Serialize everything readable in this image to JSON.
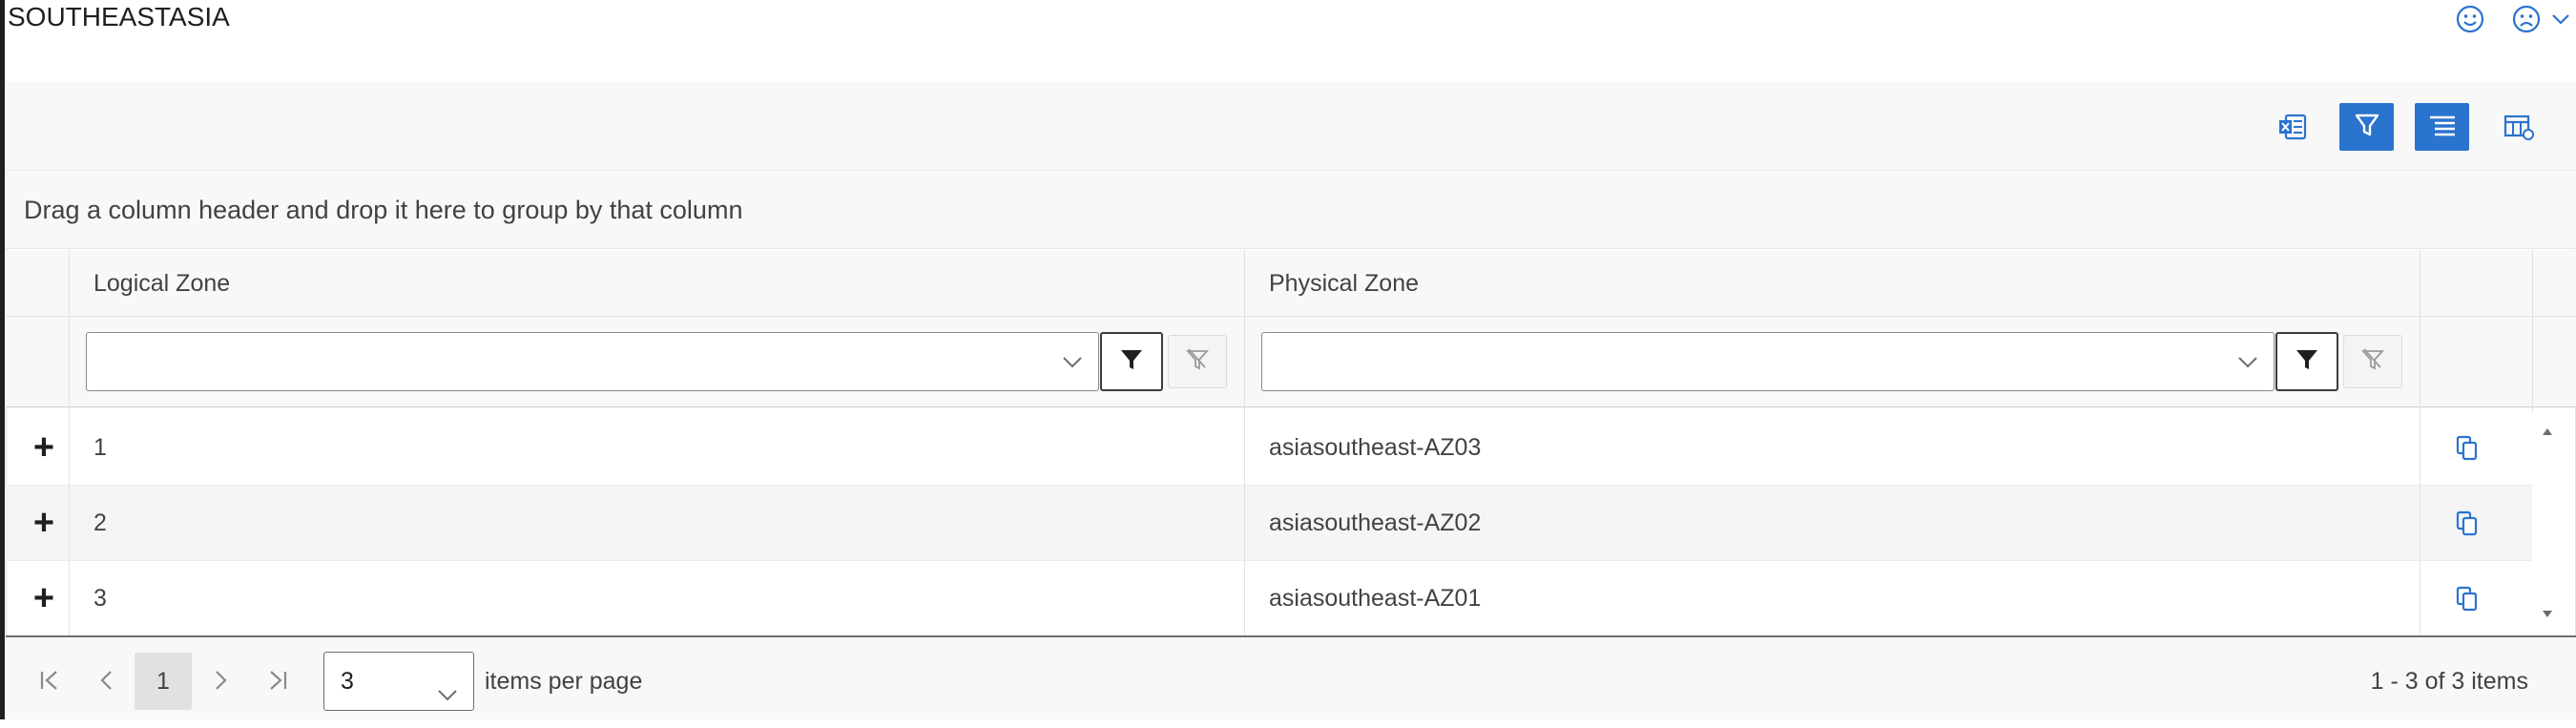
{
  "title": "SOUTHEASTASIA",
  "feedback": {
    "smile": "smile-face-icon",
    "frown": "frown-face-icon"
  },
  "toolbar": {
    "export_icon": "excel-export-icon",
    "filter_icon": "filter-icon",
    "list_icon": "list-view-icon",
    "columns_icon": "column-chooser-icon"
  },
  "grouping_hint": "Drag a column header and drop it here to group by that column",
  "columns": [
    "Logical Zone",
    "Physical Zone"
  ],
  "filters": {
    "logical_value": "",
    "physical_value": ""
  },
  "rows": [
    {
      "logical": "1",
      "physical": "asiasoutheast-AZ03"
    },
    {
      "logical": "2",
      "physical": "asiasoutheast-AZ02"
    },
    {
      "logical": "3",
      "physical": "asiasoutheast-AZ01"
    }
  ],
  "expand_symbol": "+",
  "pager": {
    "current_page": "1",
    "page_size": "3",
    "items_per_page_label": "items per page",
    "summary": "1 - 3 of 3 items"
  },
  "colors": {
    "accent": "#2a73cf",
    "border": "#e1e1e1",
    "header_bg": "#f8f8f8"
  }
}
